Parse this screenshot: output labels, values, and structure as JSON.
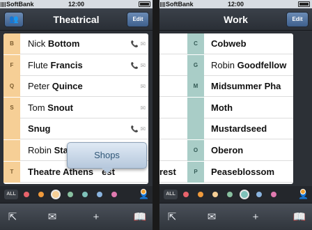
{
  "left_screen": {
    "status": {
      "carrier": "SoftBank",
      "time": "12:00"
    },
    "nav": {
      "title": "Theatrical",
      "edit_label": "Edit",
      "groups_icon": "people-icon"
    },
    "rows": [
      {
        "tab": "B",
        "first": "Nick",
        "last": "Bottom",
        "phone": true,
        "mail": true
      },
      {
        "tab": "F",
        "first": "Flute",
        "last": "Francis",
        "phone": true,
        "mail": true
      },
      {
        "tab": "Q",
        "first": "Peter",
        "last": "Quince",
        "phone": false,
        "mail": true
      },
      {
        "tab": "S",
        "first": "Tom",
        "last": "Snout",
        "phone": false,
        "mail": true
      },
      {
        "tab": "",
        "first": "",
        "last": "Snug",
        "phone": true,
        "mail": true
      },
      {
        "tab": "",
        "first": "Robin",
        "last": "Sta",
        "phone": false,
        "mail": false
      },
      {
        "tab": "T",
        "first": "",
        "last": "Theatre Athens",
        "last_tail": "est",
        "phone": false,
        "mail": false
      }
    ],
    "popover": {
      "label": "Shops"
    },
    "all_label": "ALL"
  },
  "right_screen": {
    "status": {
      "carrier": "SoftBank",
      "time": "12:00"
    },
    "nav": {
      "title": "Work",
      "edit_label": "Edit",
      "groups_icon": "people-icon"
    },
    "ghost_text": "rest",
    "rows": [
      {
        "tab": "C",
        "first": "",
        "last": "Cobweb",
        "phone": true,
        "mail": true
      },
      {
        "tab": "G",
        "first": "Robin",
        "last": "Goodfellow",
        "phone": true,
        "mail": true
      },
      {
        "tab": "M",
        "first": "",
        "last": "Midsummer Pha",
        "phone": false,
        "mail": true
      },
      {
        "tab": "",
        "first": "",
        "last": "Moth",
        "phone": false,
        "mail": true
      },
      {
        "tab": "",
        "first": "",
        "last": "Mustardseed",
        "phone": false,
        "mail": true
      },
      {
        "tab": "O",
        "first": "",
        "last": "Oberon",
        "phone": false,
        "mail": true
      },
      {
        "tab": "P",
        "first": "",
        "last": "Peaseblossom",
        "phone": false,
        "mail": false
      }
    ],
    "all_label": "ALL"
  },
  "colors": {
    "left_tab": "#f6cf96",
    "right_tab": "#a9cdc7",
    "palette": [
      "#e8636b",
      "#f09a3c",
      "#f6cf96",
      "#88c0a0",
      "#7fc2ba",
      "#8ab4e0",
      "#e07ab0"
    ],
    "left_selected": 2,
    "right_selected": 4
  },
  "toolbar": {
    "icons": [
      "share-icon",
      "mail-icon",
      "add-icon",
      "book-icon"
    ],
    "glyphs": [
      "⇱",
      "✉",
      "+",
      "📖"
    ]
  }
}
